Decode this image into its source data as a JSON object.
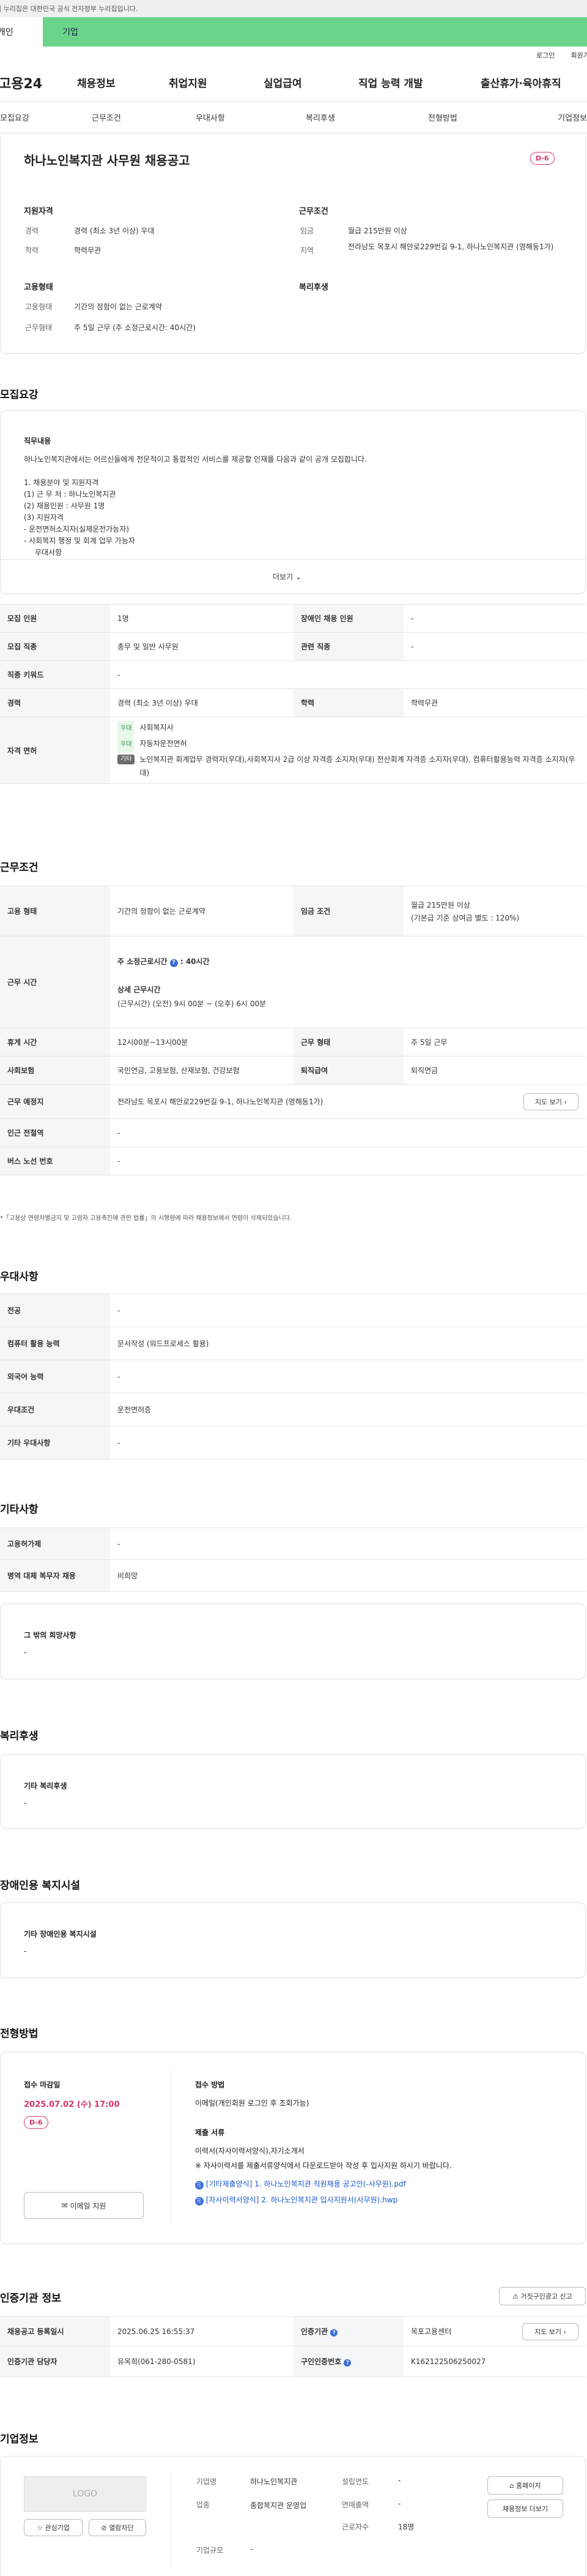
{
  "top_notice": "이 누리집은 대한민국 공식 전자정부 누리집입니다.",
  "green_tabs": [
    "개인",
    "기업"
  ],
  "util": [
    "로그인",
    "회원가입"
  ],
  "logo": "고용24",
  "main_menu": [
    "채용정보",
    "취업지원",
    "실업급여",
    "직업 능력 개발",
    "출산휴가·육아휴직"
  ],
  "sub_menu": [
    "모집요강",
    "근무조건",
    "우대사항",
    "복리후생",
    "전형방법",
    "기업정보"
  ],
  "job_title": "하나노인복지관 사무원 채용공고",
  "dday": "D-6",
  "summary": {
    "qual_title": "지원자격",
    "qual": [
      [
        "경력",
        "경력 (최소 3년 이상) 우대"
      ],
      [
        "학력",
        "학력무관"
      ]
    ],
    "cond_title": "근무조건",
    "cond": [
      [
        "임금",
        "월급 215만원 이상"
      ],
      [
        "지역",
        "전라남도 목포시 해안로229번길 9-1, 하나노인복지관 (영해동1가)"
      ]
    ],
    "emp_title": "고용형태",
    "emp": [
      [
        "고용형태",
        "기간의 정함이 없는 근로계약"
      ],
      [
        "근무형태",
        "주 5일 근무 (주 소정근로시간: 40시간)"
      ]
    ],
    "welfare_title": "복리후생"
  },
  "recruit": {
    "title": "모집요강",
    "content_label": "직무내용",
    "lines": [
      "하나노인복지관에서는 어르신들에게 전문적이고 통합적인 서비스를 제공할 인재를 다음과 같이 공개 모집합니다.",
      "",
      "1. 채용분야 및 지원자격",
      "(1) 근 무 처 : 하나노인복지관",
      "(2) 채용인원 : 사무원 1명",
      "(3) 지원자격",
      "- 운전면허소지자(실제운전가능자)",
      "- 사회복지 행정 및 회계 업무 가능자",
      "  우대사항"
    ],
    "more": "더보기",
    "rows": [
      [
        "모집 인원",
        "1명",
        "장애인 채용 인원",
        "-"
      ],
      [
        "모집 직종",
        "총무 및 일반 사무원",
        "관련 직종",
        "-"
      ],
      [
        "직종 키워드",
        "-"
      ],
      [
        "경력",
        "경력 (최소 3년 이상) 우대",
        "학력",
        "학력무관"
      ]
    ],
    "license_label": "자격 면허",
    "licenses": [
      [
        "우대",
        "사회복지사"
      ],
      [
        "우대",
        "자동차운전면허"
      ],
      [
        "기타",
        "노인복지관 회계업무 경력자(우대),사회복지사 2급 이상 자격증 소지자(우대) 전산회계 자격증 소지자(우대), 컴퓨터활용능력 자격증 소지자(우대)"
      ]
    ]
  },
  "work": {
    "title": "근무조건",
    "emp_label": "고용 형태",
    "emp": "기간의 정함이 없는 근로계약",
    "wage_label": "임금 조건",
    "wage1": "월급 215만원 이상",
    "wage2": "(기본급 기준 상여금 별도 : 120%)",
    "time_label": "근무 시간",
    "weekly": "주 소정근로시간",
    "weekly_val": ": 40시간",
    "detail_label": "상세 근무시간",
    "detail": "(근무시간) (오전) 9시 00분 ~ (오후) 6시 00분",
    "rest_label": "휴게 시간",
    "rest": "12시00분~13시00분",
    "shape_label": "근무 형태",
    "shape": "주 5일 근무",
    "ins_label": "사회보험",
    "ins": "국민연금, 고용보험, 산재보험, 건강보험",
    "ret_label": "퇴직급여",
    "ret": "퇴직연금",
    "place_label": "근무 예정지",
    "place": "전라남도 목포시 해안로229번길 9-1, 하나노인복지관 (영해동1가)",
    "map": "지도 보기",
    "sub_label": "인근 전철역",
    "sub": "-",
    "bus_label": "버스 노선 번호",
    "bus": "-",
    "note": "*「고용상 연령차별금지 및 고령자 고용촉진에 관한 법률」의 시행령에 따라 채용정보에서 연령이 삭제되었습니다."
  },
  "pref": {
    "title": "우대사항",
    "rows": [
      [
        "전공",
        "-"
      ],
      [
        "컴퓨터 활용 능력",
        "문서작성 (워드프로세스 활용)"
      ],
      [
        "외국어 능력",
        "-"
      ],
      [
        "우대조건",
        "운전면허증"
      ],
      [
        "기타 우대사항",
        "-"
      ]
    ]
  },
  "etc": {
    "title": "기타사항",
    "rows": [
      [
        "고용허가제",
        "-"
      ],
      [
        "병역 대체 복무자 채용",
        "비희망"
      ]
    ],
    "hope_label": "그 밖의 희망사항",
    "hope": "-"
  },
  "welfare": {
    "title": "복리후생",
    "label": "기타 복리후생",
    "val": "-"
  },
  "disab": {
    "title": "장애인용 복지시설",
    "label": "기타 장애인용 복지시설",
    "val": "-"
  },
  "select": {
    "title": "전형방법",
    "deadline_label": "접수 마감일",
    "deadline": "2025.07.02 (수) 17:00",
    "dday": "D-6",
    "email_btn": "이메일 지원",
    "method_label": "접수 방법",
    "method": "이메일(개인회원 로그인 후 조회가능)",
    "docs_label": "제출 서류",
    "docs1": "이력서(자사이력서양식),자기소개서",
    "docs2": "※ 자사이력서를 제출서류양식에서 다운로드받아 작성 후 입사지원 하시기 바랍니다.",
    "file1": "[기타제출양식] 1. 하나노인복지관 직원채용 공고안(-사무원).pdf",
    "file2": "[자사이력서양식] 2. 하나노인복지관 입사지원서(사무원).hwp"
  },
  "cert": {
    "title": "인증기관 정보",
    "report": "거짓구인광고 신고",
    "reg_label": "채용공고 등록일시",
    "reg": "2025.06.25 16:55:37",
    "org_label": "인증기관",
    "org": "목포고용센터",
    "map": "지도 보기",
    "mgr_label": "인증기관 담당자",
    "mgr": "유옥희(061-280-0581)",
    "no_label": "구인인증번호",
    "no": "K162122506250027"
  },
  "company": {
    "title": "기업정보",
    "logo": "LOGO",
    "fav": "관심기업",
    "block": "열람차단",
    "rows": [
      [
        "기업명",
        "하나노인복지관",
        "설립연도",
        "-"
      ],
      [
        "업종",
        "종합복지관 운영업",
        "연매출액",
        "-"
      ],
      [
        "",
        "",
        "근로자수",
        "18명"
      ],
      [
        "기업규모",
        "-",
        "",
        ""
      ]
    ],
    "home": "홈페이지",
    "more": "채용정보 더보기"
  }
}
